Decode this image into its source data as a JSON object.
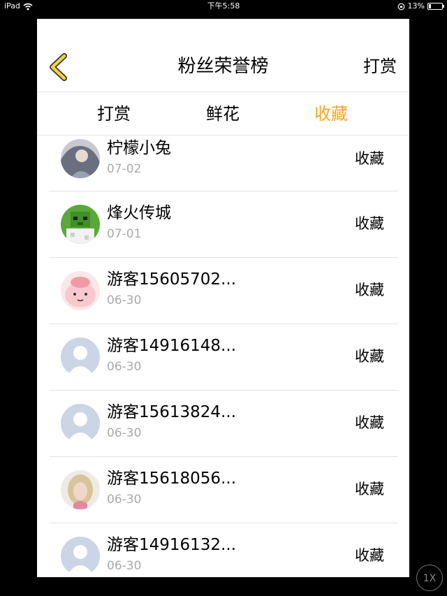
{
  "status_bar": {
    "device": "iPad",
    "time": "下午5:58",
    "battery": "13%"
  },
  "header": {
    "title": "粉丝荣誉榜",
    "right_action": "打赏"
  },
  "tabs": [
    {
      "label": "打赏",
      "active": false
    },
    {
      "label": "鲜花",
      "active": false
    },
    {
      "label": "收藏",
      "active": true
    }
  ],
  "accent_color": "#f5a623",
  "list": [
    {
      "name": "柠檬小兔",
      "date": "07-02",
      "action": "收藏",
      "avatar": "photo-avatar"
    },
    {
      "name": "烽火传城",
      "date": "07-01",
      "action": "收藏",
      "avatar": "pixel-zombie-avatar"
    },
    {
      "name": "游客15605702...",
      "date": "06-30",
      "action": "收藏",
      "avatar": "cartoon-avatar"
    },
    {
      "name": "游客14916148...",
      "date": "06-30",
      "action": "收藏",
      "avatar": "default-avatar"
    },
    {
      "name": "游客15613824...",
      "date": "06-30",
      "action": "收藏",
      "avatar": "default-avatar"
    },
    {
      "name": "游客15618056...",
      "date": "06-30",
      "action": "收藏",
      "avatar": "photo-avatar"
    },
    {
      "name": "游客14916132...",
      "date": "06-30",
      "action": "收藏",
      "avatar": "default-avatar"
    }
  ],
  "zoom_badge": "1X"
}
